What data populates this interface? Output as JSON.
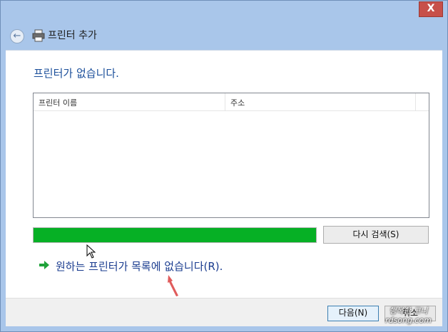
{
  "window": {
    "close_label": "X"
  },
  "nav": {
    "title": "프린터 추가"
  },
  "main": {
    "heading": "프린터가 없습니다.",
    "columns": [
      "프린터 이름",
      "주소"
    ],
    "progress_percent": 100,
    "search_again_label": "다시 검색(S)",
    "not_listed_link": "원하는 프린터가 목록에 없습니다(R)."
  },
  "footer": {
    "next_label": "다음(N)",
    "cancel_label": "취소"
  },
  "watermark": {
    "line1": "행복한 고니",
    "line2": "rdsong.com"
  },
  "colors": {
    "progress": "#06b025",
    "heading": "#1a4e9a",
    "link_arrow": "#1fa33a"
  }
}
